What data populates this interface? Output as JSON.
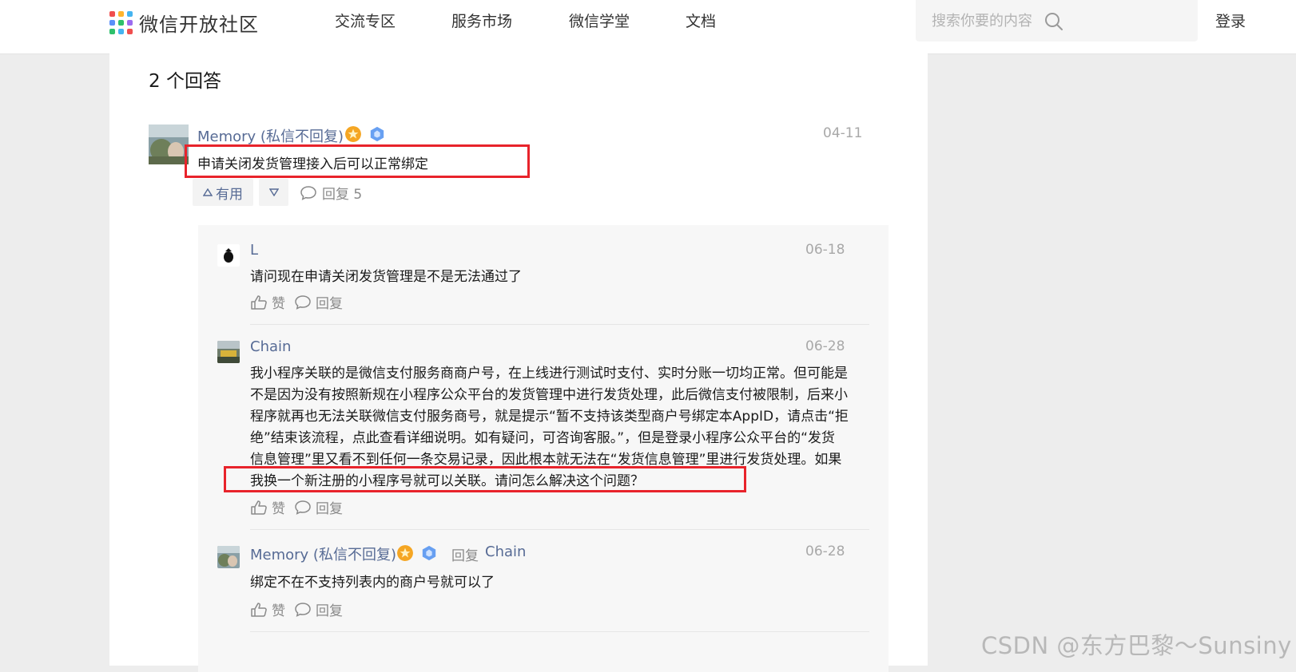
{
  "header": {
    "logo_text": "微信开放社区",
    "nav": [
      "交流专区",
      "服务市场",
      "微信学堂",
      "文档"
    ],
    "search_placeholder": "搜索你要的内容",
    "login": "登录"
  },
  "answers": {
    "title": "2 个回答",
    "first": {
      "author": "Memory (私信不回复)",
      "date": "04-11",
      "text": "申请关闭发货管理接入后可以正常绑定",
      "useful_label": "有用",
      "reply_label": "回复 5"
    },
    "replies": [
      {
        "author": "L",
        "date": "06-18",
        "text": "请问现在申请关闭发货管理是不是无法通过了",
        "like": "赞",
        "reply": "回复"
      },
      {
        "author": "Chain",
        "date": "06-28",
        "lines": [
          "我小程序关联的是微信支付服务商商户号，在上线进行测试时支付、实时分账一切均正常。但可能是",
          "不是因为没有按照新规在小程序公众平台的发货管理中进行发货处理，此后微信支付被限制，后来小",
          "程序就再也无法关联微信支付服务商号，就是提示“暂不支持该类型商户号绑定本AppID，请点击“拒",
          "绝”结束该流程，点此查看详细说明。如有疑问，可咨询客服。”，但是登录小程序公众平台的“发货",
          "信息管理”里又看不到任何一条交易记录，因此根本就无法在“发货信息管理”里进行发货处理。如果",
          "我换一个新注册的小程序号就可以关联。请问怎么解决这个问题？"
        ],
        "like": "赞",
        "reply": "回复"
      },
      {
        "author": "Memory (私信不回复)",
        "reply_word": "回复",
        "reply_to": "Chain",
        "date": "06-28",
        "text": "绑定不在不支持列表内的商户号就可以了",
        "like": "赞",
        "reply": "回复"
      }
    ]
  },
  "watermark": "CSDN @东方巴黎～Sunsiny",
  "colors": {
    "link": "#576b95",
    "highlight_box": "#e8232b",
    "muted": "#8a8a8a"
  }
}
